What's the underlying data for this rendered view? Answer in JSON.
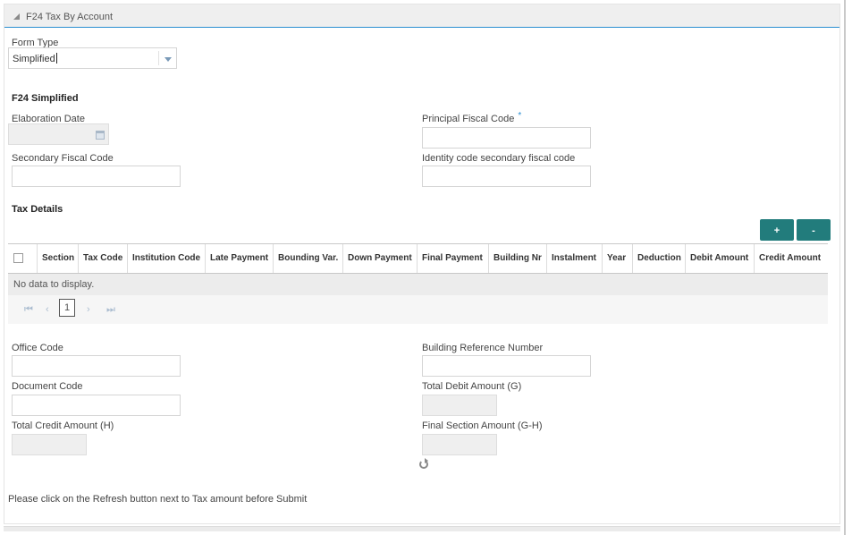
{
  "panel": {
    "title": "F24 Tax By Account"
  },
  "form_type": {
    "label": "Form Type",
    "value": "Simplified"
  },
  "section_simplified": "F24 Simplified",
  "fields": {
    "elaboration_date": {
      "label": "Elaboration Date",
      "value": ""
    },
    "principal_fiscal_code": {
      "label": "Principal Fiscal Code",
      "required_mark": "*",
      "value": ""
    },
    "secondary_fiscal_code": {
      "label": "Secondary Fiscal Code",
      "value": ""
    },
    "identity_code_secondary": {
      "label": "Identity code secondary fiscal code",
      "value": ""
    },
    "office_code": {
      "label": "Office Code",
      "value": ""
    },
    "building_reference_number": {
      "label": "Building Reference Number",
      "value": ""
    },
    "document_code": {
      "label": "Document Code",
      "value": ""
    },
    "total_debit_amount": {
      "label": "Total Debit Amount (G)",
      "value": ""
    },
    "total_credit_amount": {
      "label": "Total Credit Amount (H)",
      "value": ""
    },
    "final_section_amount": {
      "label": "Final Section Amount (G-H)",
      "value": ""
    }
  },
  "tax_details": {
    "title": "Tax Details",
    "add_label": "+",
    "remove_label": "-",
    "columns": [
      "Section",
      "Tax Code",
      "Institution Code",
      "Late Payment",
      "Bounding Var.",
      "Down Payment",
      "Final Payment",
      "Building Nr",
      "Instalment",
      "Year",
      "Deduction",
      "Debit Amount",
      "Credit Amount"
    ],
    "empty_text": "No data to display.",
    "pager": {
      "first": "⏮",
      "prev": "‹",
      "page": "1",
      "next": "›",
      "last": "⏭"
    }
  },
  "footer_note": "Please click on the Refresh button next to Tax amount before Submit",
  "icons": {
    "collapse": "collapse-triangle-icon",
    "dropdown": "chevron-down-icon",
    "calendar": "calendar-icon",
    "refresh": "refresh-icon"
  },
  "colors": {
    "accent": "#2c8fd1",
    "button": "#227c7c"
  }
}
